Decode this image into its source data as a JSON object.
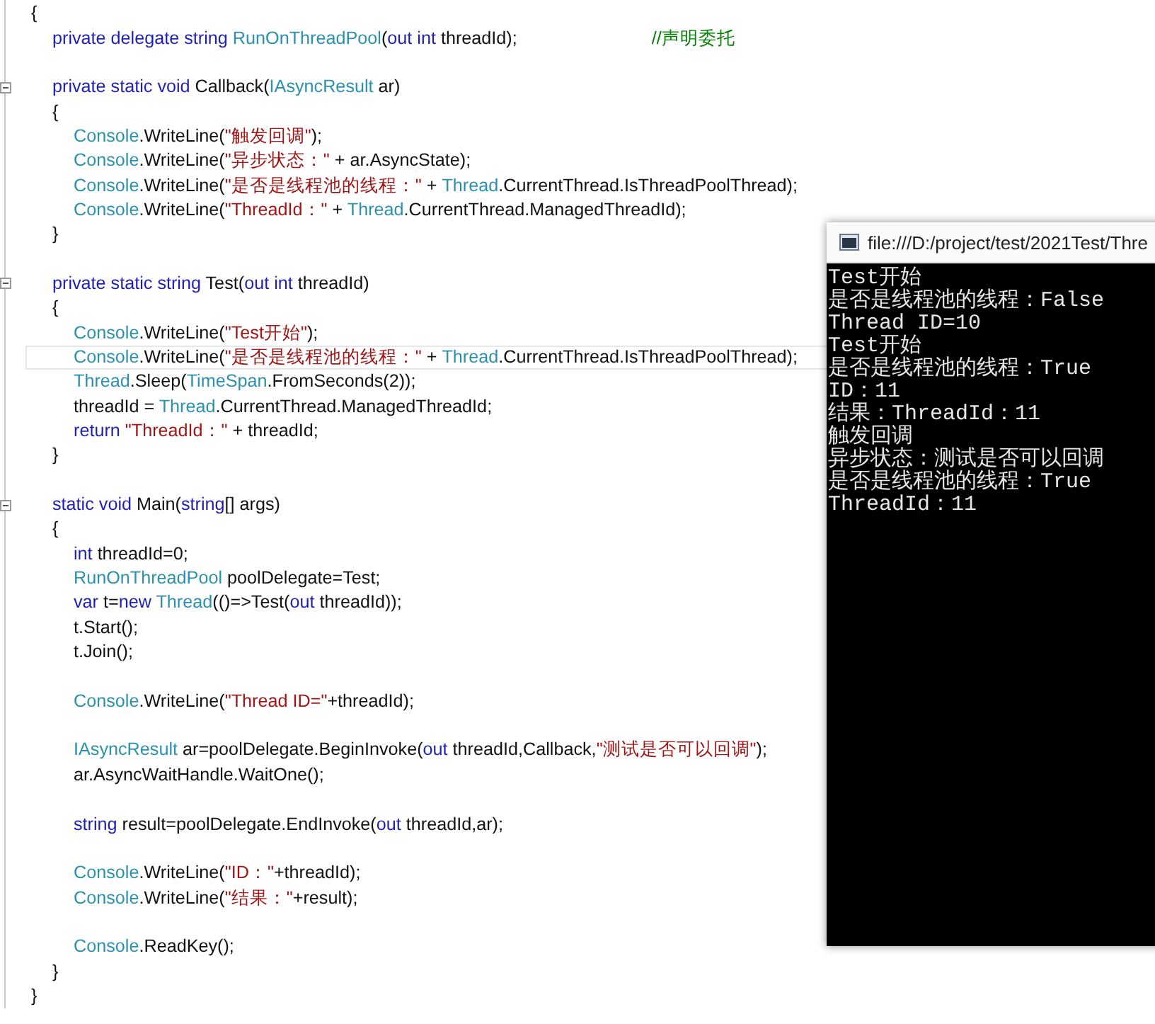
{
  "editor": {
    "lines": [
      {
        "kind": "code",
        "tokens": [
          {
            "kind": "plain",
            "text": "{"
          }
        ],
        "children": [
          {
            "kind": "code",
            "tokens": [
              {
                "kind": "kw",
                "text": "private delegate string "
              },
              {
                "kind": "type",
                "text": "RunOnThreadPool"
              },
              {
                "kind": "plain",
                "text": "("
              },
              {
                "kind": "kw",
                "text": "out int"
              },
              {
                "kind": "plain",
                "text": " threadId);"
              },
              {
                "kind": "comment",
                "text": "//声明委托"
              }
            ]
          },
          {
            "kind": "blank"
          },
          {
            "kind": "code",
            "collapsible": true,
            "tokens": [
              {
                "kind": "kw",
                "text": "private static void "
              },
              {
                "kind": "plain",
                "text": "Callback("
              },
              {
                "kind": "type",
                "text": "IAsyncResult"
              },
              {
                "kind": "plain",
                "text": " ar)"
              }
            ]
          },
          {
            "kind": "code",
            "tokens": [
              {
                "kind": "plain",
                "text": "{"
              }
            ],
            "children": [
              {
                "kind": "code",
                "tokens": [
                  {
                    "kind": "type",
                    "text": "Console"
                  },
                  {
                    "kind": "plain",
                    "text": ".WriteLine("
                  },
                  {
                    "kind": "str",
                    "text": "\"触发回调\""
                  },
                  {
                    "kind": "plain",
                    "text": ");"
                  }
                ]
              },
              {
                "kind": "code",
                "tokens": [
                  {
                    "kind": "type",
                    "text": "Console"
                  },
                  {
                    "kind": "plain",
                    "text": ".WriteLine("
                  },
                  {
                    "kind": "str",
                    "text": "\"异步状态：\""
                  },
                  {
                    "kind": "plain",
                    "text": " + ar.AsyncState);"
                  }
                ]
              },
              {
                "kind": "code",
                "tokens": [
                  {
                    "kind": "type",
                    "text": "Console"
                  },
                  {
                    "kind": "plain",
                    "text": ".WriteLine("
                  },
                  {
                    "kind": "str",
                    "text": "\"是否是线程池的线程：\""
                  },
                  {
                    "kind": "plain",
                    "text": " + "
                  },
                  {
                    "kind": "type",
                    "text": "Thread"
                  },
                  {
                    "kind": "plain",
                    "text": ".CurrentThread.IsThreadPoolThread);"
                  }
                ]
              },
              {
                "kind": "code",
                "tokens": [
                  {
                    "kind": "type",
                    "text": "Console"
                  },
                  {
                    "kind": "plain",
                    "text": ".WriteLine("
                  },
                  {
                    "kind": "str",
                    "text": "\"ThreadId：\""
                  },
                  {
                    "kind": "plain",
                    "text": " + "
                  },
                  {
                    "kind": "type",
                    "text": "Thread"
                  },
                  {
                    "kind": "plain",
                    "text": ".CurrentThread.ManagedThreadId);"
                  }
                ]
              }
            ]
          },
          {
            "kind": "code",
            "tokens": [
              {
                "kind": "plain",
                "text": "}"
              }
            ]
          },
          {
            "kind": "blank"
          },
          {
            "kind": "code",
            "collapsible": true,
            "tokens": [
              {
                "kind": "kw",
                "text": "private static string "
              },
              {
                "kind": "plain",
                "text": "Test("
              },
              {
                "kind": "kw",
                "text": "out int"
              },
              {
                "kind": "plain",
                "text": " threadId)"
              }
            ]
          },
          {
            "kind": "code",
            "tokens": [
              {
                "kind": "plain",
                "text": "{"
              }
            ],
            "children": [
              {
                "kind": "code",
                "tokens": [
                  {
                    "kind": "type",
                    "text": "Console"
                  },
                  {
                    "kind": "plain",
                    "text": ".WriteLine("
                  },
                  {
                    "kind": "str",
                    "text": "\"Test开始\""
                  },
                  {
                    "kind": "plain",
                    "text": ");"
                  }
                ]
              },
              {
                "kind": "code",
                "current": true,
                "tokens": [
                  {
                    "kind": "type",
                    "text": "Console"
                  },
                  {
                    "kind": "plain",
                    "text": ".WriteLine("
                  },
                  {
                    "kind": "str",
                    "text": "\"是否是线程池的线程：\""
                  },
                  {
                    "kind": "plain",
                    "text": " + "
                  },
                  {
                    "kind": "type",
                    "text": "Thread"
                  },
                  {
                    "kind": "plain",
                    "text": ".CurrentThread.IsThreadPoolThread);"
                  }
                ]
              },
              {
                "kind": "code",
                "tokens": [
                  {
                    "kind": "type",
                    "text": "Thread"
                  },
                  {
                    "kind": "plain",
                    "text": ".Sleep("
                  },
                  {
                    "kind": "type",
                    "text": "TimeSpan"
                  },
                  {
                    "kind": "plain",
                    "text": ".FromSeconds(2));"
                  }
                ]
              },
              {
                "kind": "code",
                "tokens": [
                  {
                    "kind": "plain",
                    "text": "threadId = "
                  },
                  {
                    "kind": "type",
                    "text": "Thread"
                  },
                  {
                    "kind": "plain",
                    "text": ".CurrentThread.ManagedThreadId;"
                  }
                ]
              },
              {
                "kind": "code",
                "tokens": [
                  {
                    "kind": "kw",
                    "text": "return "
                  },
                  {
                    "kind": "str",
                    "text": "\"ThreadId：\""
                  },
                  {
                    "kind": "plain",
                    "text": " + threadId;"
                  }
                ]
              }
            ]
          },
          {
            "kind": "code",
            "tokens": [
              {
                "kind": "plain",
                "text": "}"
              }
            ]
          },
          {
            "kind": "blank"
          },
          {
            "kind": "code",
            "collapsible": true,
            "tokens": [
              {
                "kind": "kw",
                "text": "static void "
              },
              {
                "kind": "plain",
                "text": "Main("
              },
              {
                "kind": "kw",
                "text": "string"
              },
              {
                "kind": "plain",
                "text": "[] args)"
              }
            ]
          },
          {
            "kind": "code",
            "tokens": [
              {
                "kind": "plain",
                "text": "{"
              }
            ],
            "children": [
              {
                "kind": "code",
                "tokens": [
                  {
                    "kind": "kw",
                    "text": "int "
                  },
                  {
                    "kind": "plain",
                    "text": "threadId=0;"
                  }
                ]
              },
              {
                "kind": "code",
                "tokens": [
                  {
                    "kind": "type",
                    "text": "RunOnThreadPool"
                  },
                  {
                    "kind": "plain",
                    "text": " poolDelegate=Test;"
                  }
                ]
              },
              {
                "kind": "code",
                "tokens": [
                  {
                    "kind": "kw",
                    "text": "var "
                  },
                  {
                    "kind": "plain",
                    "text": "t="
                  },
                  {
                    "kind": "kw",
                    "text": "new "
                  },
                  {
                    "kind": "type",
                    "text": "Thread"
                  },
                  {
                    "kind": "plain",
                    "text": "(()=>Test("
                  },
                  {
                    "kind": "kw",
                    "text": "out"
                  },
                  {
                    "kind": "plain",
                    "text": " threadId));"
                  }
                ]
              },
              {
                "kind": "code",
                "tokens": [
                  {
                    "kind": "plain",
                    "text": "t.Start();"
                  }
                ]
              },
              {
                "kind": "code",
                "tokens": [
                  {
                    "kind": "plain",
                    "text": "t.Join();"
                  }
                ]
              },
              {
                "kind": "blank"
              },
              {
                "kind": "code",
                "tokens": [
                  {
                    "kind": "type",
                    "text": "Console"
                  },
                  {
                    "kind": "plain",
                    "text": ".WriteLine("
                  },
                  {
                    "kind": "str",
                    "text": "\"Thread ID=\""
                  },
                  {
                    "kind": "plain",
                    "text": "+threadId);"
                  }
                ]
              },
              {
                "kind": "blank"
              },
              {
                "kind": "code",
                "tokens": [
                  {
                    "kind": "type",
                    "text": "IAsyncResult"
                  },
                  {
                    "kind": "plain",
                    "text": " ar=poolDelegate.BeginInvoke("
                  },
                  {
                    "kind": "kw",
                    "text": "out"
                  },
                  {
                    "kind": "plain",
                    "text": " threadId,Callback,"
                  },
                  {
                    "kind": "str",
                    "text": "\"测试是否可以回调\""
                  },
                  {
                    "kind": "plain",
                    "text": ");"
                  }
                ]
              },
              {
                "kind": "code",
                "tokens": [
                  {
                    "kind": "plain",
                    "text": "ar.AsyncWaitHandle.WaitOne();"
                  }
                ]
              },
              {
                "kind": "blank"
              },
              {
                "kind": "code",
                "tokens": [
                  {
                    "kind": "kw",
                    "text": "string "
                  },
                  {
                    "kind": "plain",
                    "text": "result=poolDelegate.EndInvoke("
                  },
                  {
                    "kind": "kw",
                    "text": "out"
                  },
                  {
                    "kind": "plain",
                    "text": " threadId,ar);"
                  }
                ]
              },
              {
                "kind": "blank"
              },
              {
                "kind": "code",
                "tokens": [
                  {
                    "kind": "type",
                    "text": "Console"
                  },
                  {
                    "kind": "plain",
                    "text": ".WriteLine("
                  },
                  {
                    "kind": "str",
                    "text": "\"ID：\""
                  },
                  {
                    "kind": "plain",
                    "text": "+threadId);"
                  }
                ]
              },
              {
                "kind": "code",
                "tokens": [
                  {
                    "kind": "type",
                    "text": "Console"
                  },
                  {
                    "kind": "plain",
                    "text": ".WriteLine("
                  },
                  {
                    "kind": "str",
                    "text": "\"结果：\""
                  },
                  {
                    "kind": "plain",
                    "text": "+result);"
                  }
                ]
              },
              {
                "kind": "blank"
              },
              {
                "kind": "code",
                "tokens": [
                  {
                    "kind": "type",
                    "text": "Console"
                  },
                  {
                    "kind": "plain",
                    "text": ".ReadKey();"
                  }
                ]
              }
            ]
          },
          {
            "kind": "code",
            "tokens": [
              {
                "kind": "plain",
                "text": "}"
              }
            ]
          }
        ]
      },
      {
        "kind": "code",
        "tokens": [
          {
            "kind": "plain",
            "text": "}"
          }
        ]
      }
    ]
  },
  "console": {
    "title": "file:///D:/project/test/2021Test/Thre",
    "lines": [
      "Test开始",
      "是否是线程池的线程：False",
      "Thread ID=10",
      "Test开始",
      "是否是线程池的线程：True",
      "ID：11",
      "结果：ThreadId：11",
      "触发回调",
      "异步状态：测试是否可以回调",
      "是否是线程池的线程：True",
      "ThreadId：11"
    ]
  }
}
